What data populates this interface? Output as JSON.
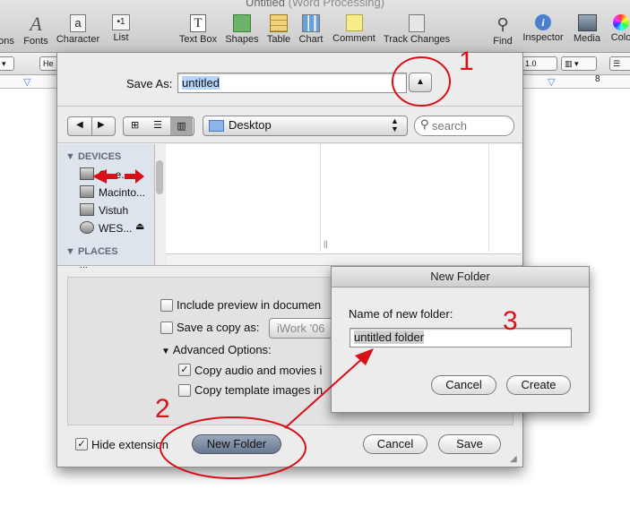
{
  "window": {
    "title": "Untitled",
    "subtitle": "(Word Processing)"
  },
  "toolbar": {
    "items": [
      {
        "label": "ons"
      },
      {
        "label": "Fonts"
      },
      {
        "label": "Character"
      },
      {
        "label": "List"
      },
      {
        "label": "Text Box"
      },
      {
        "label": "Shapes"
      },
      {
        "label": "Table"
      },
      {
        "label": "Chart"
      },
      {
        "label": "Comment"
      },
      {
        "label": "Track Changes"
      },
      {
        "label": "Find"
      },
      {
        "label": "Inspector"
      },
      {
        "label": "Media"
      },
      {
        "label": "Colo"
      }
    ]
  },
  "formatbar": {
    "font": "He",
    "zoom": "1.0"
  },
  "ruler": {
    "mark": "8"
  },
  "save_sheet": {
    "save_as_label": "Save As:",
    "filename": "untitled",
    "location": "Desktop",
    "search_placeholder": "search",
    "sidebar": {
      "devices_heading": "DEVICES",
      "places_heading": "PLACES",
      "devices": [
        {
          "label": "C...e..."
        },
        {
          "label": "Macinto..."
        },
        {
          "label": "Vistuh"
        },
        {
          "label": "WES..."
        }
      ],
      "places_first": "…"
    },
    "options": {
      "include_preview": "Include preview in documen",
      "save_copy_as": "Save a copy as:",
      "save_copy_format": "iWork '06",
      "advanced_options": "Advanced Options:",
      "copy_audio": "Copy audio and movies i",
      "copy_template": "Copy template images in"
    },
    "hide_extension": "Hide extension",
    "new_folder": "New Folder",
    "cancel": "Cancel",
    "save": "Save"
  },
  "new_folder_dialog": {
    "title": "New Folder",
    "name_label": "Name of new folder:",
    "name_value": "untitled folder",
    "cancel": "Cancel",
    "create": "Create"
  },
  "annotations": {
    "one": "1",
    "two": "2",
    "three": "3"
  },
  "colors": {
    "annotation_red": "#d8101a",
    "accent_blue": "#4a7fd0"
  }
}
